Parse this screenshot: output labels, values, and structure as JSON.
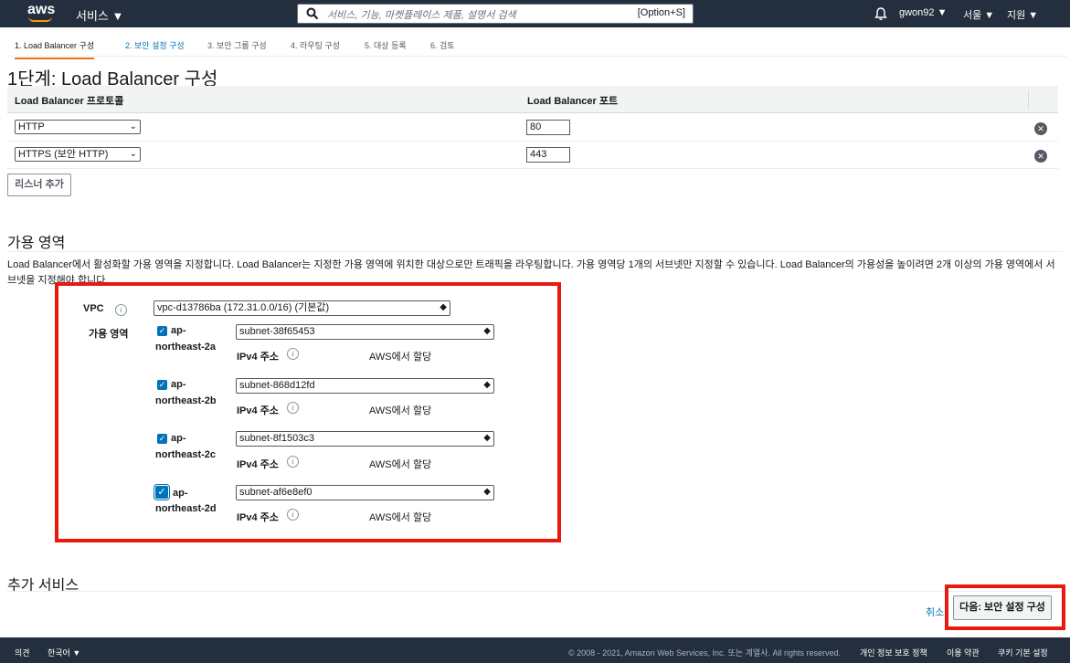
{
  "nav": {
    "logo": "aws",
    "services": "서비스 ▼",
    "search_placeholder": "서비스, 기능, 마켓플레이스 제품, 설명서 검색",
    "search_shortcut": "[Option+S]",
    "user": "gwon92 ▼",
    "region": "서울 ▼",
    "support": "지원 ▼"
  },
  "steps": [
    {
      "label": "1. Load Balancer 구성"
    },
    {
      "label": "2. 보안 설정 구성"
    },
    {
      "label": "3. 보안 그룹 구성"
    },
    {
      "label": "4. 라우팅 구성"
    },
    {
      "label": "5. 대상 등록"
    },
    {
      "label": "6. 검토"
    }
  ],
  "page_title": "1단계: Load Balancer 구성",
  "listeners": {
    "col_protocol": "Load Balancer 프로토콜",
    "col_port": "Load Balancer 포트",
    "rows": [
      {
        "protocol": "HTTP",
        "port": "80"
      },
      {
        "protocol": "HTTPS (보안 HTTP)",
        "port": "443"
      }
    ],
    "remove_glyph": "✕",
    "add_button": "리스너 추가"
  },
  "az_section": {
    "title": "가용 영역",
    "description": "Load Balancer에서 활성화할 가용 영역을 지정합니다. Load Balancer는 지정한 가용 영역에 위치한 대상으로만 트래픽을 라우팅합니다. 가용 영역당 1개의 서브넷만 지정할 수 있습니다. Load Balancer의 가용성을 높이려면 2개 이상의 가용 영역에서 서브넷을 지정해야 합니다.",
    "vpc_label": "VPC",
    "vpc_value": "vpc-d13786ba (172.31.0.0/16) (기본값)",
    "az_label": "가용 영역",
    "ipv4_label": "IPv4 주소",
    "assign_text": "AWS에서 할당",
    "zones": [
      {
        "line1": "ap-",
        "line2": "northeast-2a",
        "subnet": "subnet-38f65453"
      },
      {
        "line1": "ap-",
        "line2": "northeast-2b",
        "subnet": "subnet-868d12fd"
      },
      {
        "line1": "ap-",
        "line2": "northeast-2c",
        "subnet": "subnet-8f1503c3"
      },
      {
        "line1": "ap-",
        "line2": "northeast-2d",
        "subnet": "subnet-af6e8ef0"
      }
    ]
  },
  "additional": {
    "title": "추가 서비스"
  },
  "actions": {
    "cancel": "취소",
    "next": "다음: 보안 설정 구성"
  },
  "footer": {
    "feedback": "의견",
    "language": "한국어 ▼",
    "copyright": "© 2008 - 2021, Amazon Web Services, Inc. 또는 계열사. All rights reserved.",
    "privacy": "개인 정보 보호 정책",
    "terms": "이용 약관",
    "cookies": "쿠키 기본 설정"
  },
  "colors": {
    "nav_bg": "#232f3e",
    "accent": "#ec7211",
    "link": "#0073bb",
    "highlight": "#e8190f"
  }
}
